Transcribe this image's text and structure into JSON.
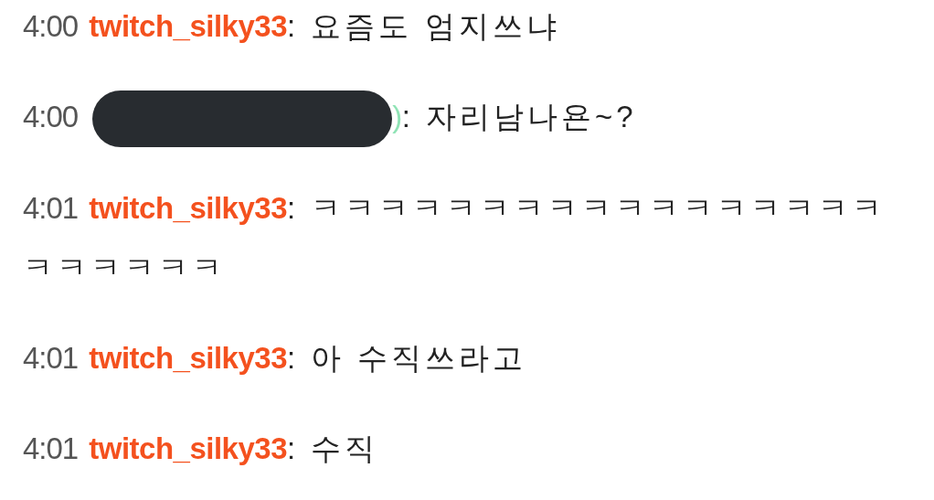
{
  "chat_messages": [
    {
      "time": "4:00",
      "redacted": false,
      "username": "twitch_silky33",
      "color": "#f4511e",
      "text": ": 요즘도 엄지쓰냐"
    },
    {
      "time": "4:00",
      "redacted": true,
      "username": ")",
      "color": "#8fe3b5",
      "text": ": 자리남나욘~?"
    },
    {
      "time": "4:01",
      "redacted": false,
      "username": "twitch_silky33",
      "color": "#f4511e",
      "text": ": ㅋㅋㅋㅋㅋㅋㅋㅋㅋㅋㅋㅋㅋㅋㅋㅋㅋㅋㅋㅋㅋㅋㅋ"
    },
    {
      "time": "4:01",
      "redacted": false,
      "username": "twitch_silky33",
      "color": "#f4511e",
      "text": ": 아 수직쓰라고"
    },
    {
      "time": "4:01",
      "redacted": false,
      "username": "twitch_silky33",
      "color": "#f4511e",
      "text": ": 수직"
    }
  ]
}
